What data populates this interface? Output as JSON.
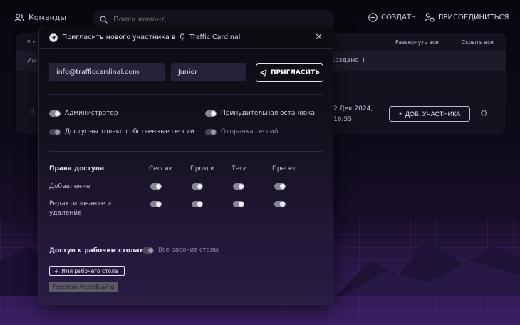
{
  "topbar": {
    "teams_label": "Команды",
    "search_placeholder": "Поиск команд",
    "create_label": "СОЗДАТЬ",
    "join_label": "ПРИСОЕДИНИТЬСЯ"
  },
  "background_panel": {
    "all_label": "Все",
    "expand_all": "Развернуть все",
    "collapse_all": "Скрыть все",
    "col_name": "Им",
    "col_created": "Создано ↓",
    "row_date": "2 Дек 2024, 16:55",
    "add_member_label": "ДОБ. УЧАСТНИКА"
  },
  "modal": {
    "title": "Пригласить нового участника в",
    "team_name": "Traffic Cardinal",
    "email_value": "info@trafficcardinal.com",
    "role_value": "Junior",
    "invite_label": "ПРИГЛАСИТЬ",
    "options": {
      "admin": "Администратор",
      "forced_stop": "Принудительная остановка",
      "own_sessions": "Доступны только собственные сессии",
      "send_sessions": "Отправка сессий"
    },
    "permissions": {
      "title": "Права доступа",
      "columns": [
        "Сессии",
        "Прокси",
        "Теги",
        "Пресет"
      ],
      "rows": [
        "Добавление",
        "Редактирование и удаление"
      ]
    },
    "workspaces": {
      "title": "Доступ к рабочим столам",
      "all_label": "Все рабочие столы",
      "add_label": "Имя рабочего стола",
      "tag": "Facebook MediaBuying"
    }
  }
}
